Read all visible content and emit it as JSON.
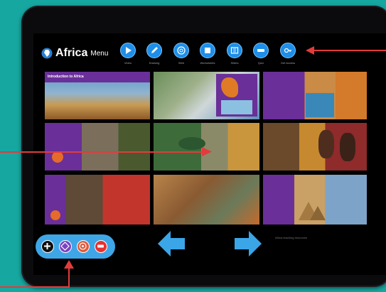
{
  "app": {
    "title": "Africa",
    "menu_label": "Menu"
  },
  "nav_buttons": [
    {
      "label": "Video",
      "icon": "play-icon"
    },
    {
      "label": "Drawing",
      "icon": "pencil-icon"
    },
    {
      "label": "Web",
      "icon": "globe-icon"
    },
    {
      "label": "Worksheets",
      "icon": "book-icon"
    },
    {
      "label": "Slides",
      "icon": "slides-icon"
    },
    {
      "label": "Quiz",
      "icon": "quiz-icon"
    },
    {
      "label": "Get Access",
      "icon": "key-icon"
    }
  ],
  "tiles": [
    {
      "caption": "Introduction to Africa"
    },
    {
      "caption": ""
    },
    {
      "caption": ""
    },
    {
      "caption": ""
    },
    {
      "caption": ""
    },
    {
      "caption": ""
    },
    {
      "caption": ""
    },
    {
      "caption": ""
    },
    {
      "caption": ""
    }
  ],
  "tools": [
    {
      "label": "",
      "icon": "plus-icon"
    },
    {
      "label": "",
      "icon": "pattern-icon"
    },
    {
      "label": "",
      "icon": "target-icon"
    },
    {
      "label": "",
      "icon": "badge-icon"
    }
  ],
  "credit": "Africa teaching resources",
  "colors": {
    "background": "#17a7a1",
    "accent": "#1e8ee8",
    "callout": "#e23b3b",
    "tile_band": "#6a2f98"
  }
}
